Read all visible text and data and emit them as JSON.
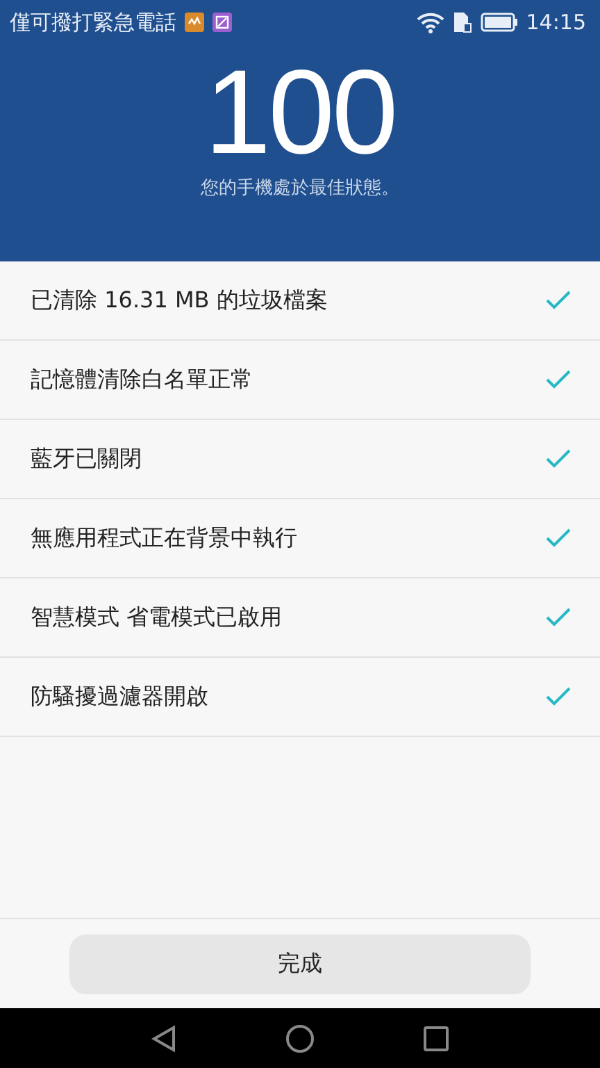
{
  "status_bar": {
    "carrier": "僅可撥打緊急電話",
    "time": "14:15"
  },
  "header": {
    "score": "100",
    "message": "您的手機處於最佳狀態。"
  },
  "results": [
    {
      "label": "已清除 16.31 MB 的垃圾檔案",
      "checked": true
    },
    {
      "label": "記憶體清除白名單正常",
      "checked": true
    },
    {
      "label": "藍牙已關閉",
      "checked": true
    },
    {
      "label": "無應用程式正在背景中執行",
      "checked": true
    },
    {
      "label": "智慧模式 省電模式已啟用",
      "checked": true
    },
    {
      "label": "防騷擾過濾器開啟",
      "checked": true
    }
  ],
  "done_button": "完成"
}
